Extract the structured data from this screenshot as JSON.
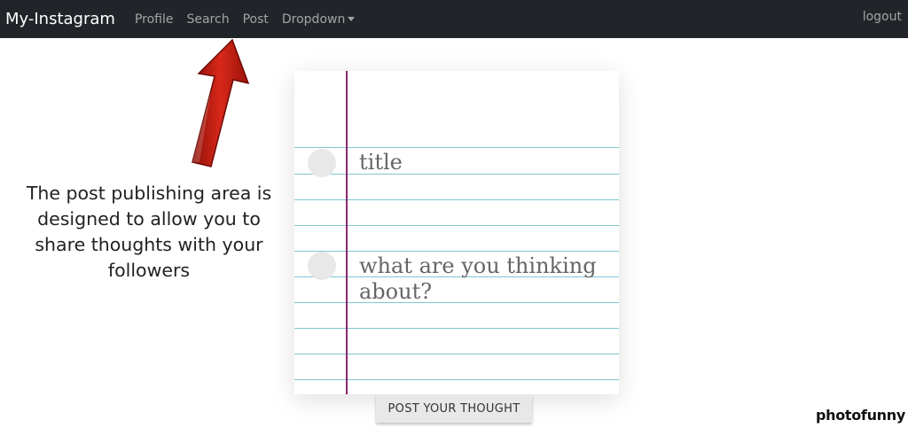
{
  "navbar": {
    "brand": "My-Instagram",
    "links": [
      "Profile",
      "Search",
      "Post",
      "Dropdown"
    ],
    "logout": "logout"
  },
  "annotation": {
    "text": "The post publishing area is designed to allow you to share thoughts with your followers"
  },
  "form": {
    "title_placeholder": "title",
    "body_placeholder": "what are you thinking about?",
    "submit_label": "POST YOUR THOUGHT"
  },
  "watermark": "photofunny",
  "colors": {
    "navbar_bg": "#212529",
    "arrow": "#c21a10",
    "paper_line": "#7fc4d6",
    "margin_line": "#8c2a6b"
  },
  "icons": {
    "dropdown": "caret-down-icon",
    "arrow": "arrow-up-icon"
  }
}
